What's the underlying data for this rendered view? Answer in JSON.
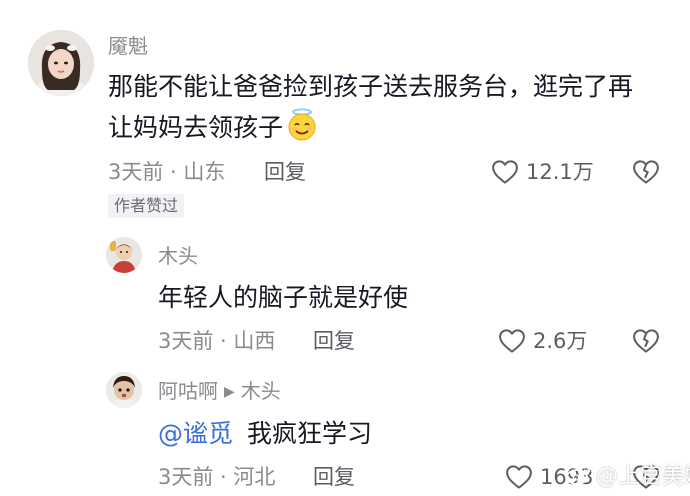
{
  "comments": [
    {
      "username": "魇魁",
      "text_line1": "那能不能让爸爸捡到孩子送去服务台，逛完了再",
      "text_line2": "让妈妈去领孩子",
      "emoji_icon": "smiling-face-with-halo-icon",
      "time_location": "3天前 · 山东",
      "reply_label": "回复",
      "like_count": "12.1万",
      "badge": "作者赞过"
    },
    {
      "username": "木头",
      "text": "年轻人的脑子就是好使",
      "time_location": "3天前 · 山西",
      "reply_label": "回复",
      "like_count": "2.6万"
    },
    {
      "username": "阿咕啊",
      "reply_to": "木头",
      "mention": "@谧觅",
      "text": "我疯狂学习",
      "time_location": "3天前 · 河北",
      "reply_label": "回复",
      "like_count": "1693"
    }
  ],
  "watermark": "@上官美婧",
  "icons": {
    "like": "heart-outline-icon",
    "dislike": "broken-heart-icon",
    "reply_arrow": "triangle-right-icon",
    "watermark_logo": "weibo-logo-icon"
  },
  "colors": {
    "text": "#161823",
    "secondary": "#8a8b91",
    "mention": "#3a6fd8",
    "badge_bg": "#f1f2f5"
  }
}
